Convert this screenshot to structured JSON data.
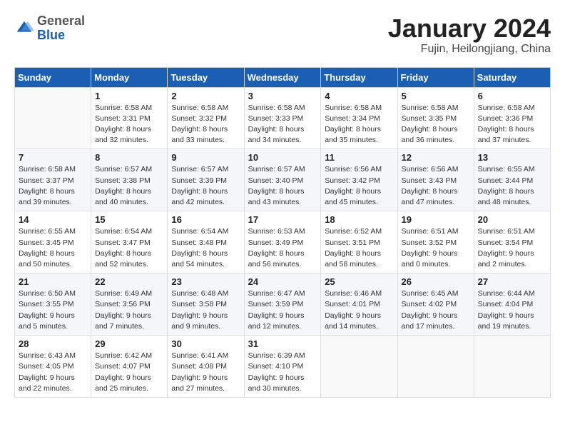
{
  "header": {
    "logo_general": "General",
    "logo_blue": "Blue",
    "month_title": "January 2024",
    "location": "Fujin, Heilongjiang, China"
  },
  "weekdays": [
    "Sunday",
    "Monday",
    "Tuesday",
    "Wednesday",
    "Thursday",
    "Friday",
    "Saturday"
  ],
  "weeks": [
    [
      {
        "day": "",
        "sunrise": "",
        "sunset": "",
        "daylight": ""
      },
      {
        "day": "1",
        "sunrise": "6:58 AM",
        "sunset": "3:31 PM",
        "daylight": "8 hours and 32 minutes."
      },
      {
        "day": "2",
        "sunrise": "6:58 AM",
        "sunset": "3:32 PM",
        "daylight": "8 hours and 33 minutes."
      },
      {
        "day": "3",
        "sunrise": "6:58 AM",
        "sunset": "3:33 PM",
        "daylight": "8 hours and 34 minutes."
      },
      {
        "day": "4",
        "sunrise": "6:58 AM",
        "sunset": "3:34 PM",
        "daylight": "8 hours and 35 minutes."
      },
      {
        "day": "5",
        "sunrise": "6:58 AM",
        "sunset": "3:35 PM",
        "daylight": "8 hours and 36 minutes."
      },
      {
        "day": "6",
        "sunrise": "6:58 AM",
        "sunset": "3:36 PM",
        "daylight": "8 hours and 37 minutes."
      }
    ],
    [
      {
        "day": "7",
        "sunrise": "6:58 AM",
        "sunset": "3:37 PM",
        "daylight": "8 hours and 39 minutes."
      },
      {
        "day": "8",
        "sunrise": "6:57 AM",
        "sunset": "3:38 PM",
        "daylight": "8 hours and 40 minutes."
      },
      {
        "day": "9",
        "sunrise": "6:57 AM",
        "sunset": "3:39 PM",
        "daylight": "8 hours and 42 minutes."
      },
      {
        "day": "10",
        "sunrise": "6:57 AM",
        "sunset": "3:40 PM",
        "daylight": "8 hours and 43 minutes."
      },
      {
        "day": "11",
        "sunrise": "6:56 AM",
        "sunset": "3:42 PM",
        "daylight": "8 hours and 45 minutes."
      },
      {
        "day": "12",
        "sunrise": "6:56 AM",
        "sunset": "3:43 PM",
        "daylight": "8 hours and 47 minutes."
      },
      {
        "day": "13",
        "sunrise": "6:55 AM",
        "sunset": "3:44 PM",
        "daylight": "8 hours and 48 minutes."
      }
    ],
    [
      {
        "day": "14",
        "sunrise": "6:55 AM",
        "sunset": "3:45 PM",
        "daylight": "8 hours and 50 minutes."
      },
      {
        "day": "15",
        "sunrise": "6:54 AM",
        "sunset": "3:47 PM",
        "daylight": "8 hours and 52 minutes."
      },
      {
        "day": "16",
        "sunrise": "6:54 AM",
        "sunset": "3:48 PM",
        "daylight": "8 hours and 54 minutes."
      },
      {
        "day": "17",
        "sunrise": "6:53 AM",
        "sunset": "3:49 PM",
        "daylight": "8 hours and 56 minutes."
      },
      {
        "day": "18",
        "sunrise": "6:52 AM",
        "sunset": "3:51 PM",
        "daylight": "8 hours and 58 minutes."
      },
      {
        "day": "19",
        "sunrise": "6:51 AM",
        "sunset": "3:52 PM",
        "daylight": "9 hours and 0 minutes."
      },
      {
        "day": "20",
        "sunrise": "6:51 AM",
        "sunset": "3:54 PM",
        "daylight": "9 hours and 2 minutes."
      }
    ],
    [
      {
        "day": "21",
        "sunrise": "6:50 AM",
        "sunset": "3:55 PM",
        "daylight": "9 hours and 5 minutes."
      },
      {
        "day": "22",
        "sunrise": "6:49 AM",
        "sunset": "3:56 PM",
        "daylight": "9 hours and 7 minutes."
      },
      {
        "day": "23",
        "sunrise": "6:48 AM",
        "sunset": "3:58 PM",
        "daylight": "9 hours and 9 minutes."
      },
      {
        "day": "24",
        "sunrise": "6:47 AM",
        "sunset": "3:59 PM",
        "daylight": "9 hours and 12 minutes."
      },
      {
        "day": "25",
        "sunrise": "6:46 AM",
        "sunset": "4:01 PM",
        "daylight": "9 hours and 14 minutes."
      },
      {
        "day": "26",
        "sunrise": "6:45 AM",
        "sunset": "4:02 PM",
        "daylight": "9 hours and 17 minutes."
      },
      {
        "day": "27",
        "sunrise": "6:44 AM",
        "sunset": "4:04 PM",
        "daylight": "9 hours and 19 minutes."
      }
    ],
    [
      {
        "day": "28",
        "sunrise": "6:43 AM",
        "sunset": "4:05 PM",
        "daylight": "9 hours and 22 minutes."
      },
      {
        "day": "29",
        "sunrise": "6:42 AM",
        "sunset": "4:07 PM",
        "daylight": "9 hours and 25 minutes."
      },
      {
        "day": "30",
        "sunrise": "6:41 AM",
        "sunset": "4:08 PM",
        "daylight": "9 hours and 27 minutes."
      },
      {
        "day": "31",
        "sunrise": "6:39 AM",
        "sunset": "4:10 PM",
        "daylight": "9 hours and 30 minutes."
      },
      {
        "day": "",
        "sunrise": "",
        "sunset": "",
        "daylight": ""
      },
      {
        "day": "",
        "sunrise": "",
        "sunset": "",
        "daylight": ""
      },
      {
        "day": "",
        "sunrise": "",
        "sunset": "",
        "daylight": ""
      }
    ]
  ]
}
